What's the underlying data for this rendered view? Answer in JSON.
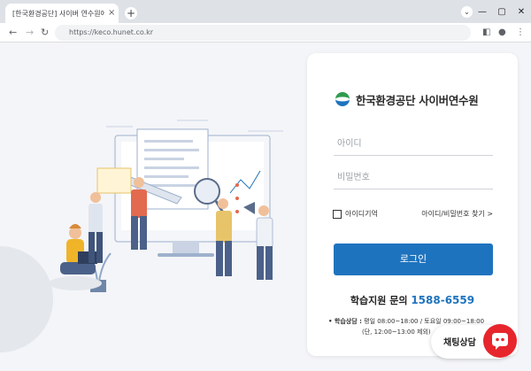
{
  "browser": {
    "tab_title": "[한국환경공단] 사이버 연수원에",
    "tab_close": "×",
    "new_tab": "+",
    "tab_search": "⌄",
    "minimize": "—",
    "maximize": "▢",
    "close": "✕",
    "back": "←",
    "forward": "→",
    "reload": "↻",
    "url": "https://keco.hunet.co.kr",
    "sidepanel": "◧",
    "profile": "●",
    "menu": "⋮"
  },
  "login": {
    "logo_text": "한국환경공단 사이버연수원",
    "id_placeholder": "아이디",
    "pw_placeholder": "비밀번호",
    "remember_label": "아이디기억",
    "find_link": "아이디/비밀번호 찾기 >",
    "login_button": "로그인"
  },
  "support": {
    "label": "학습지원 문의",
    "phone": "1588-6559",
    "hours_title": "• 학습상담 :",
    "hours_line1": "평일 08:00~18:00 / 토요일 09:00~18:00",
    "hours_line2": "(단, 12:00~13:00 제외)"
  },
  "chat": {
    "label": "채팅상담"
  },
  "colors": {
    "primary": "#1e73be",
    "chat_red": "#e7252c"
  }
}
